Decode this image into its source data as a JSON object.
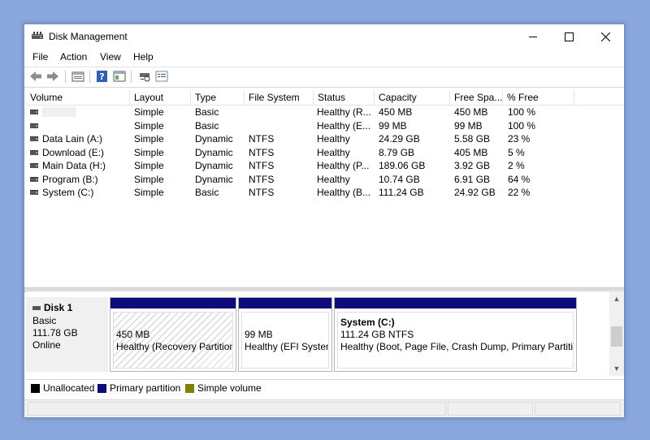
{
  "window": {
    "title": "Disk Management"
  },
  "menu": [
    "File",
    "Action",
    "View",
    "Help"
  ],
  "toolbar": {
    "icons": [
      "back-arrow-icon",
      "forward-arrow-icon",
      "properties-icon",
      "help-icon",
      "show-hide-pane-icon",
      "rescan-icon",
      "console-icon"
    ]
  },
  "list": {
    "columns": [
      "Volume",
      "Layout",
      "Type",
      "File System",
      "Status",
      "Capacity",
      "Free Spa...",
      "% Free"
    ],
    "rows": [
      {
        "volume": "",
        "layout": "Simple",
        "type": "Basic",
        "fs": "",
        "status": "Healthy (R...",
        "capacity": "450 MB",
        "free": "450 MB",
        "pct": "100 %"
      },
      {
        "volume": "",
        "layout": "Simple",
        "type": "Basic",
        "fs": "",
        "status": "Healthy (E...",
        "capacity": "99 MB",
        "free": "99 MB",
        "pct": "100 %"
      },
      {
        "volume": "Data Lain (A:)",
        "layout": "Simple",
        "type": "Dynamic",
        "fs": "NTFS",
        "status": "Healthy",
        "capacity": "24.29 GB",
        "free": "5.58 GB",
        "pct": "23 %"
      },
      {
        "volume": "Download (E:)",
        "layout": "Simple",
        "type": "Dynamic",
        "fs": "NTFS",
        "status": "Healthy",
        "capacity": "8.79 GB",
        "free": "405 MB",
        "pct": "5 %"
      },
      {
        "volume": "Main Data (H:)",
        "layout": "Simple",
        "type": "Dynamic",
        "fs": "NTFS",
        "status": "Healthy (P...",
        "capacity": "189.06 GB",
        "free": "3.92 GB",
        "pct": "2 %"
      },
      {
        "volume": "Program (B:)",
        "layout": "Simple",
        "type": "Dynamic",
        "fs": "NTFS",
        "status": "Healthy",
        "capacity": "10.74 GB",
        "free": "6.91 GB",
        "pct": "64 %"
      },
      {
        "volume": "System (C:)",
        "layout": "Simple",
        "type": "Basic",
        "fs": "NTFS",
        "status": "Healthy (B...",
        "capacity": "111.24 GB",
        "free": "24.92 GB",
        "pct": "22 %"
      }
    ]
  },
  "disk": {
    "name": "Disk 1",
    "type": "Basic",
    "size": "111.78 GB",
    "state": "Online",
    "partitions": [
      {
        "title": "",
        "size": "450 MB",
        "status": "Healthy (Recovery Partition)"
      },
      {
        "title": "",
        "size": "99 MB",
        "status": "Healthy (EFI System Partition)"
      },
      {
        "title": "System  (C:)",
        "size": "111.24 GB NTFS",
        "status": "Healthy (Boot, Page File, Crash Dump, Primary Partition)"
      }
    ]
  },
  "legend": [
    {
      "label": "Unallocated",
      "color": "#000000"
    },
    {
      "label": "Primary partition",
      "color": "#0c0c7a"
    },
    {
      "label": "Simple volume",
      "color": "#808000"
    }
  ]
}
